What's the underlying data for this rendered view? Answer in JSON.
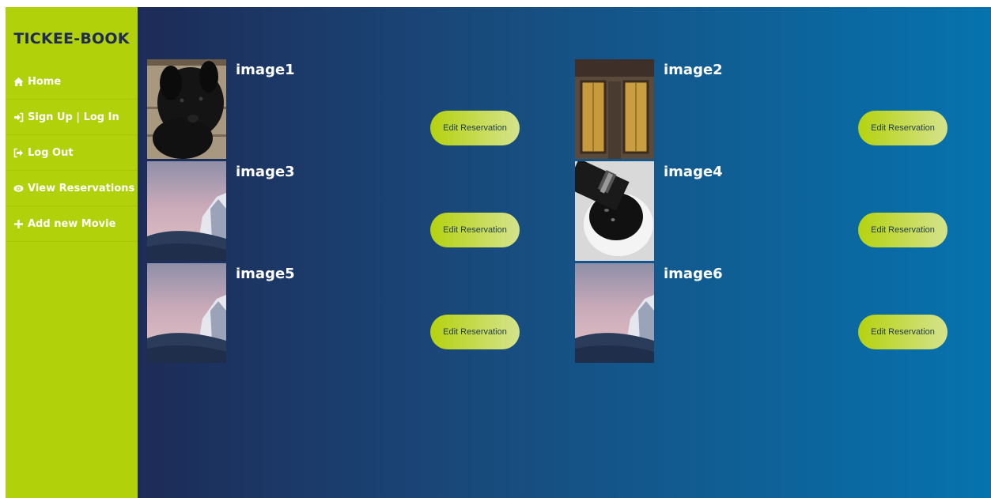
{
  "brand": "TICKEE-BOOK",
  "nav": [
    {
      "label": "Home",
      "icon": "home-icon"
    },
    {
      "label": "Sign Up | Log In",
      "icon": "sign-in-icon"
    },
    {
      "label": "Log Out",
      "icon": "sign-out-icon"
    },
    {
      "label": "View Reservations",
      "icon": "eye-icon"
    },
    {
      "label": "Add new Movie",
      "icon": "plus-icon"
    }
  ],
  "cards": [
    {
      "title": "image1",
      "button": "Edit Reservation",
      "image": "black-puppy-photo"
    },
    {
      "title": "image2",
      "button": "Edit Reservation",
      "image": "wooden-window-photo"
    },
    {
      "title": "image3",
      "button": "Edit Reservation",
      "image": "mountain-sky-photo"
    },
    {
      "title": "image4",
      "button": "Edit Reservation",
      "image": "coffee-cup-photo"
    },
    {
      "title": "image5",
      "button": "Edit Reservation",
      "image": "mountain-sky-photo"
    },
    {
      "title": "image6",
      "button": "Edit Reservation",
      "image": "mountain-sky-photo"
    }
  ],
  "colors": {
    "sidebar": "#b1d10a",
    "brand_text": "#1f2a55",
    "gradient_start": "#1d2b57",
    "gradient_end": "#0673ae"
  }
}
